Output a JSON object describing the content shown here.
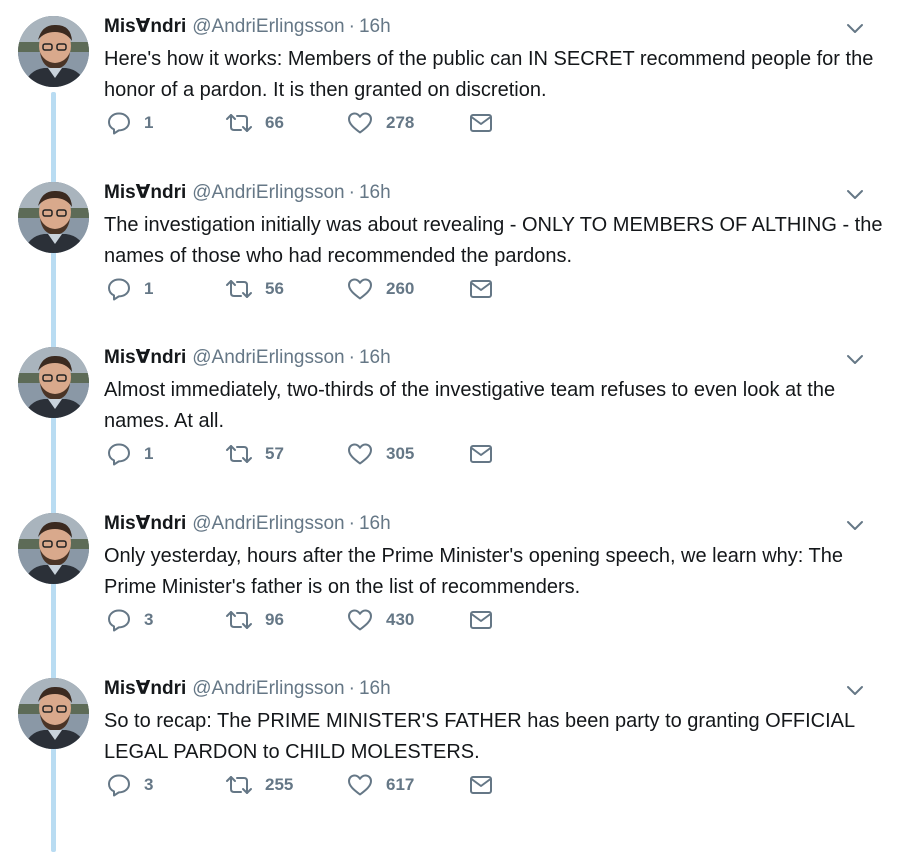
{
  "tweets": [
    {
      "author_name": "Mis∀ndri",
      "handle": "@AndriErlingsson",
      "separator": "·",
      "time": "16h",
      "text": "Here's how it works: Members of the public can IN SECRET recommend people for the honor of a pardon. It is then granted on discretion.",
      "replies": "1",
      "retweets": "66",
      "likes": "278"
    },
    {
      "author_name": "Mis∀ndri",
      "handle": "@AndriErlingsson",
      "separator": "·",
      "time": "16h",
      "text": "The investigation initially was about revealing - ONLY TO MEMBERS OF ALTHING - the names of those who had recommended the pardons.",
      "replies": "1",
      "retweets": "56",
      "likes": "260"
    },
    {
      "author_name": "Mis∀ndri",
      "handle": "@AndriErlingsson",
      "separator": "·",
      "time": "16h",
      "text": "Almost immediately, two-thirds of the investigative team refuses to even look at the names. At all.",
      "replies": "1",
      "retweets": "57",
      "likes": "305"
    },
    {
      "author_name": "Mis∀ndri",
      "handle": "@AndriErlingsson",
      "separator": "·",
      "time": "16h",
      "text": "Only yesterday, hours after the Prime Minister's opening speech, we learn why: The Prime Minister's father is on the list of recommenders.",
      "replies": "3",
      "retweets": "96",
      "likes": "430"
    },
    {
      "author_name": "Mis∀ndri",
      "handle": "@AndriErlingsson",
      "separator": "·",
      "time": "16h",
      "text": "So to recap: The PRIME MINISTER'S FATHER has been party to granting OFFICIAL LEGAL PARDON to CHILD MOLESTERS.",
      "replies": "3",
      "retweets": "255",
      "likes": "617"
    }
  ],
  "icons": {
    "reply": "reply-icon",
    "retweet": "retweet-icon",
    "like": "heart-icon",
    "dm": "envelope-icon",
    "menu": "chevron-down-icon"
  },
  "colors": {
    "thread_line": "#b9dcf2",
    "muted": "#657786",
    "text": "#14171a"
  }
}
